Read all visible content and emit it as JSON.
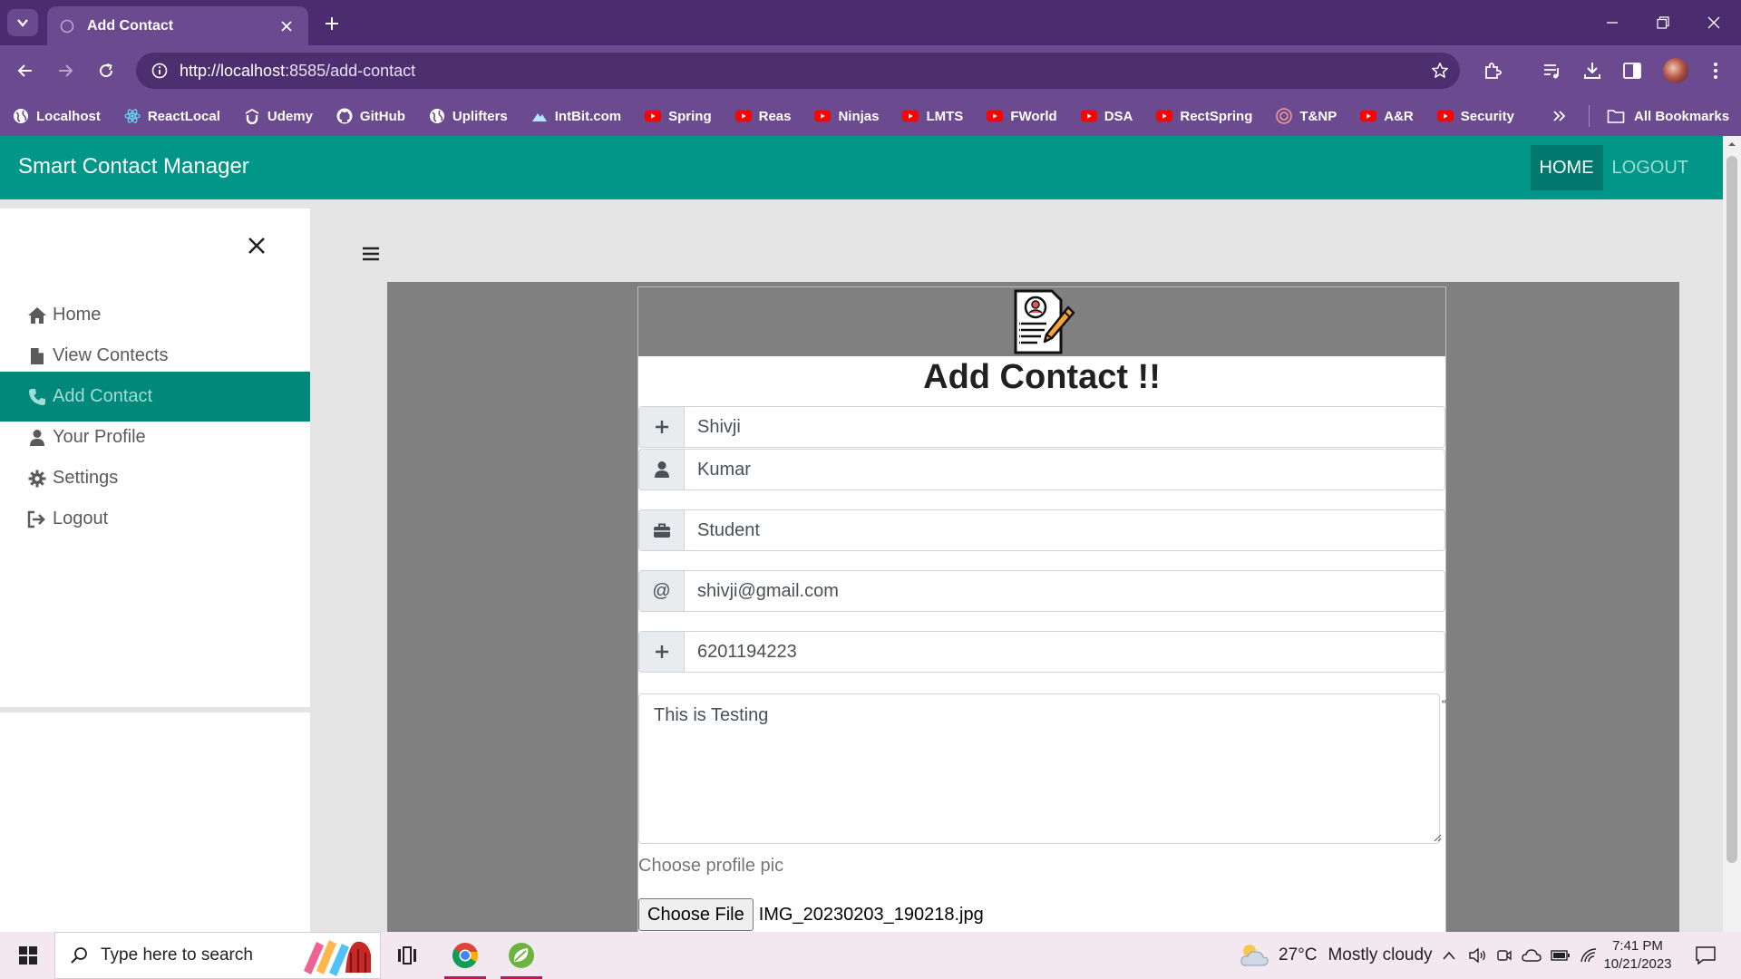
{
  "browser": {
    "tab_title": "Add Contact",
    "url_host": "http://localhost",
    "url_rest": ":8585/add-contact",
    "bookmarks": [
      {
        "label": "Localhost",
        "icon": "globe-icon"
      },
      {
        "label": "ReactLocal",
        "icon": "react-icon"
      },
      {
        "label": "Udemy",
        "icon": "udemy-icon"
      },
      {
        "label": "GitHub",
        "icon": "github-icon"
      },
      {
        "label": "Uplifters",
        "icon": "globe-icon"
      },
      {
        "label": "IntBit.com",
        "icon": "mountain-icon"
      },
      {
        "label": "Spring",
        "icon": "youtube-icon"
      },
      {
        "label": "Reas",
        "icon": "youtube-icon"
      },
      {
        "label": "Ninjas",
        "icon": "youtube-icon"
      },
      {
        "label": "LMTS",
        "icon": "youtube-icon"
      },
      {
        "label": "FWorld",
        "icon": "youtube-icon"
      },
      {
        "label": "DSA",
        "icon": "youtube-icon"
      },
      {
        "label": "RectSpring",
        "icon": "youtube-icon"
      },
      {
        "label": "T&NP",
        "icon": "badge-icon"
      },
      {
        "label": "A&R",
        "icon": "youtube-icon"
      },
      {
        "label": "Security",
        "icon": "youtube-icon"
      }
    ],
    "all_bookmarks": "All Bookmarks"
  },
  "app": {
    "brand": "Smart Contact Manager",
    "nav_home": "HOME",
    "nav_logout": "LOGOUT"
  },
  "sidebar": {
    "items": [
      {
        "label": "Home",
        "icon": "home-icon"
      },
      {
        "label": "View Contects",
        "icon": "file-icon"
      },
      {
        "label": "Add Contact",
        "icon": "phone-icon",
        "active": true
      },
      {
        "label": "Your Profile",
        "icon": "user-icon"
      },
      {
        "label": "Settings",
        "icon": "gear-icon"
      },
      {
        "label": "Logout",
        "icon": "sign-out-icon"
      }
    ]
  },
  "form": {
    "title": "Add Contact !!",
    "name": "Shivji",
    "second_name": "Kumar",
    "work": "Student",
    "email_addon": "@",
    "email": "shivji@gmail.com",
    "phone": "6201194223",
    "description": "This is Testing",
    "quote_mark": "\"",
    "pic_label": "Choose profile pic",
    "file_button": "Choose File",
    "file_name": "IMG_20230203_190218.jpg"
  },
  "taskbar": {
    "search_placeholder": "Type here to search",
    "temperature": "27°C",
    "weather": "Mostly cloudy",
    "time": "7:41 PM",
    "date": "10/21/2023"
  },
  "colors": {
    "browser_frame": "#4b2c6f",
    "browser_toolbar": "#6b4a8f",
    "app_primary": "#009688",
    "sidebar_active": "#00897b",
    "content_bg": "#808080"
  }
}
